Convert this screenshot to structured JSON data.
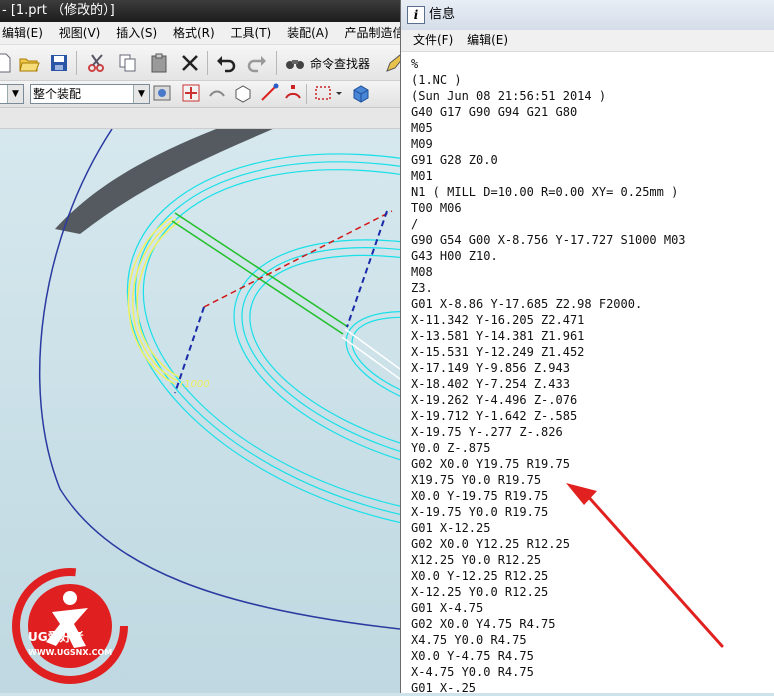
{
  "nx_window": {
    "title": "- [1.prt （修改的）]",
    "menu": [
      "编辑(E)",
      "视图(V)",
      "插入(S)",
      "格式(R)",
      "工具(T)",
      "装配(A)",
      "产品制造信息"
    ],
    "command_finder_label": "命令查找器",
    "assembly_combo_value": "整个装配",
    "graphics_label": "r1000",
    "logo_text": "UG爱好者",
    "logo_url": "WWW.UGSNX.COM"
  },
  "info_window": {
    "title": "信息",
    "icon_glyph": "i",
    "menu": [
      "文件(F)",
      "编辑(E)"
    ],
    "lines": [
      "%",
      "(1.NC )",
      "(Sun Jun 08 21:56:51 2014 )",
      "G40 G17 G90 G94 G21 G80",
      "M05",
      "M09",
      "G91 G28 Z0.0",
      "M01",
      "N1 ( MILL D=10.00 R=0.00 XY= 0.25mm )",
      "T00 M06",
      "/",
      "G90 G54 G00 X-8.756 Y-17.727 S1000 M03",
      "G43 H00 Z10.",
      "M08",
      "Z3.",
      "G01 X-8.86 Y-17.685 Z2.98 F2000.",
      "X-11.342 Y-16.205 Z2.471",
      "X-13.581 Y-14.381 Z1.961",
      "X-15.531 Y-12.249 Z1.452",
      "X-17.149 Y-9.856 Z.943",
      "X-18.402 Y-7.254 Z.433",
      "X-19.262 Y-4.496 Z-.076",
      "X-19.712 Y-1.642 Z-.585",
      "X-19.75 Y-.277 Z-.826",
      "Y0.0 Z-.875",
      "G02 X0.0 Y19.75 R19.75",
      "X19.75 Y0.0 R19.75",
      "X0.0 Y-19.75 R19.75",
      "X-19.75 Y0.0 R19.75",
      "G01 X-12.25",
      "G02 X0.0 Y12.25 R12.25",
      "X12.25 Y0.0 R12.25",
      "X0.0 Y-12.25 R12.25",
      "X-12.25 Y0.0 R12.25",
      "G01 X-4.75",
      "G02 X0.0 Y4.75 R4.75",
      "X4.75 Y0.0 R4.75",
      "X0.0 Y-4.75 R4.75",
      "X-4.75 Y0.0 R4.75",
      "G01 X-.25"
    ]
  },
  "colors": {
    "annotation_arrow": "#e0211f",
    "toolpath_cyan": "#18e0e8",
    "toolpath_green": "#22c02a",
    "rapid_red": "#d01818",
    "rapid_blue": "#1a2aa8",
    "selected_yellow": "#f0f060",
    "part_edge_blue": "#2a3aa0"
  }
}
